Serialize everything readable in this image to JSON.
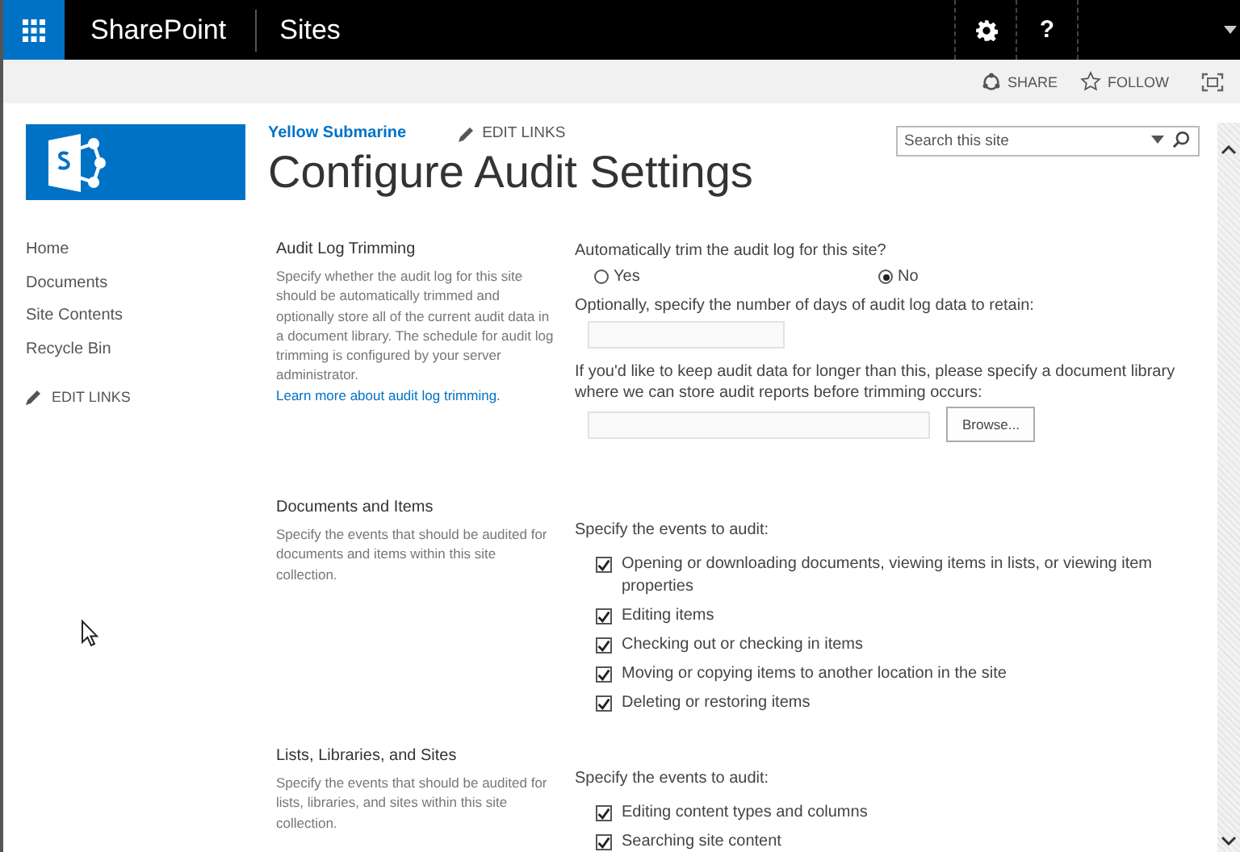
{
  "topbar": {
    "brand": "SharePoint",
    "section": "Sites",
    "help": "?"
  },
  "actions": [
    {
      "kind": "share",
      "label": "SHARE"
    },
    {
      "kind": "follow",
      "label": "FOLLOW"
    }
  ],
  "site": {
    "name": "Yellow Submarine",
    "edit_links": "EDIT LINKS",
    "title": "Configure Audit Settings",
    "search": {
      "placeholder": "Search this site"
    }
  },
  "nav": {
    "items": [
      "Home",
      "Documents",
      "Site Contents",
      "Recycle Bin"
    ],
    "edit_links": "EDIT LINKS"
  },
  "sections": [
    {
      "kind": "trimming",
      "title": "Audit Log Trimming",
      "description": "Specify whether the audit log for this site should be automatically trimmed and optionally store all of the current audit data in a document library. The schedule for audit log trimming is configured by your server administrator.",
      "link": "Learn more about audit log trimming.",
      "question": "Automatically trim the audit log for this site?",
      "options": [
        {
          "label": "Yes",
          "selected": false
        },
        {
          "label": "No",
          "selected": true
        }
      ],
      "days_label": "Optionally, specify the number of days of audit log data to retain:",
      "library_label": "If you'd like to keep audit data for longer than this, please specify a document library where we can store audit reports before trimming occurs:",
      "browse": "Browse..."
    },
    {
      "kind": "events",
      "title": "Documents and Items",
      "description": "Specify the events that should be audited for documents and items within this site collection.",
      "events_label": "Specify the events to audit:",
      "events": [
        {
          "label": "Opening or downloading documents, viewing items in lists, or viewing item properties",
          "checked": true
        },
        {
          "label": "Editing items",
          "checked": true
        },
        {
          "label": "Checking out or checking in items",
          "checked": true
        },
        {
          "label": "Moving or copying items to another location in the site",
          "checked": true
        },
        {
          "label": "Deleting or restoring items",
          "checked": true
        }
      ]
    },
    {
      "kind": "events",
      "title": "Lists, Libraries, and Sites",
      "description": "Specify the events that should be audited for lists, libraries, and sites within this site collection.",
      "events_label": "Specify the events to audit:",
      "events": [
        {
          "label": "Editing content types and columns",
          "checked": true
        },
        {
          "label": "Searching site content",
          "checked": true
        }
      ]
    }
  ]
}
